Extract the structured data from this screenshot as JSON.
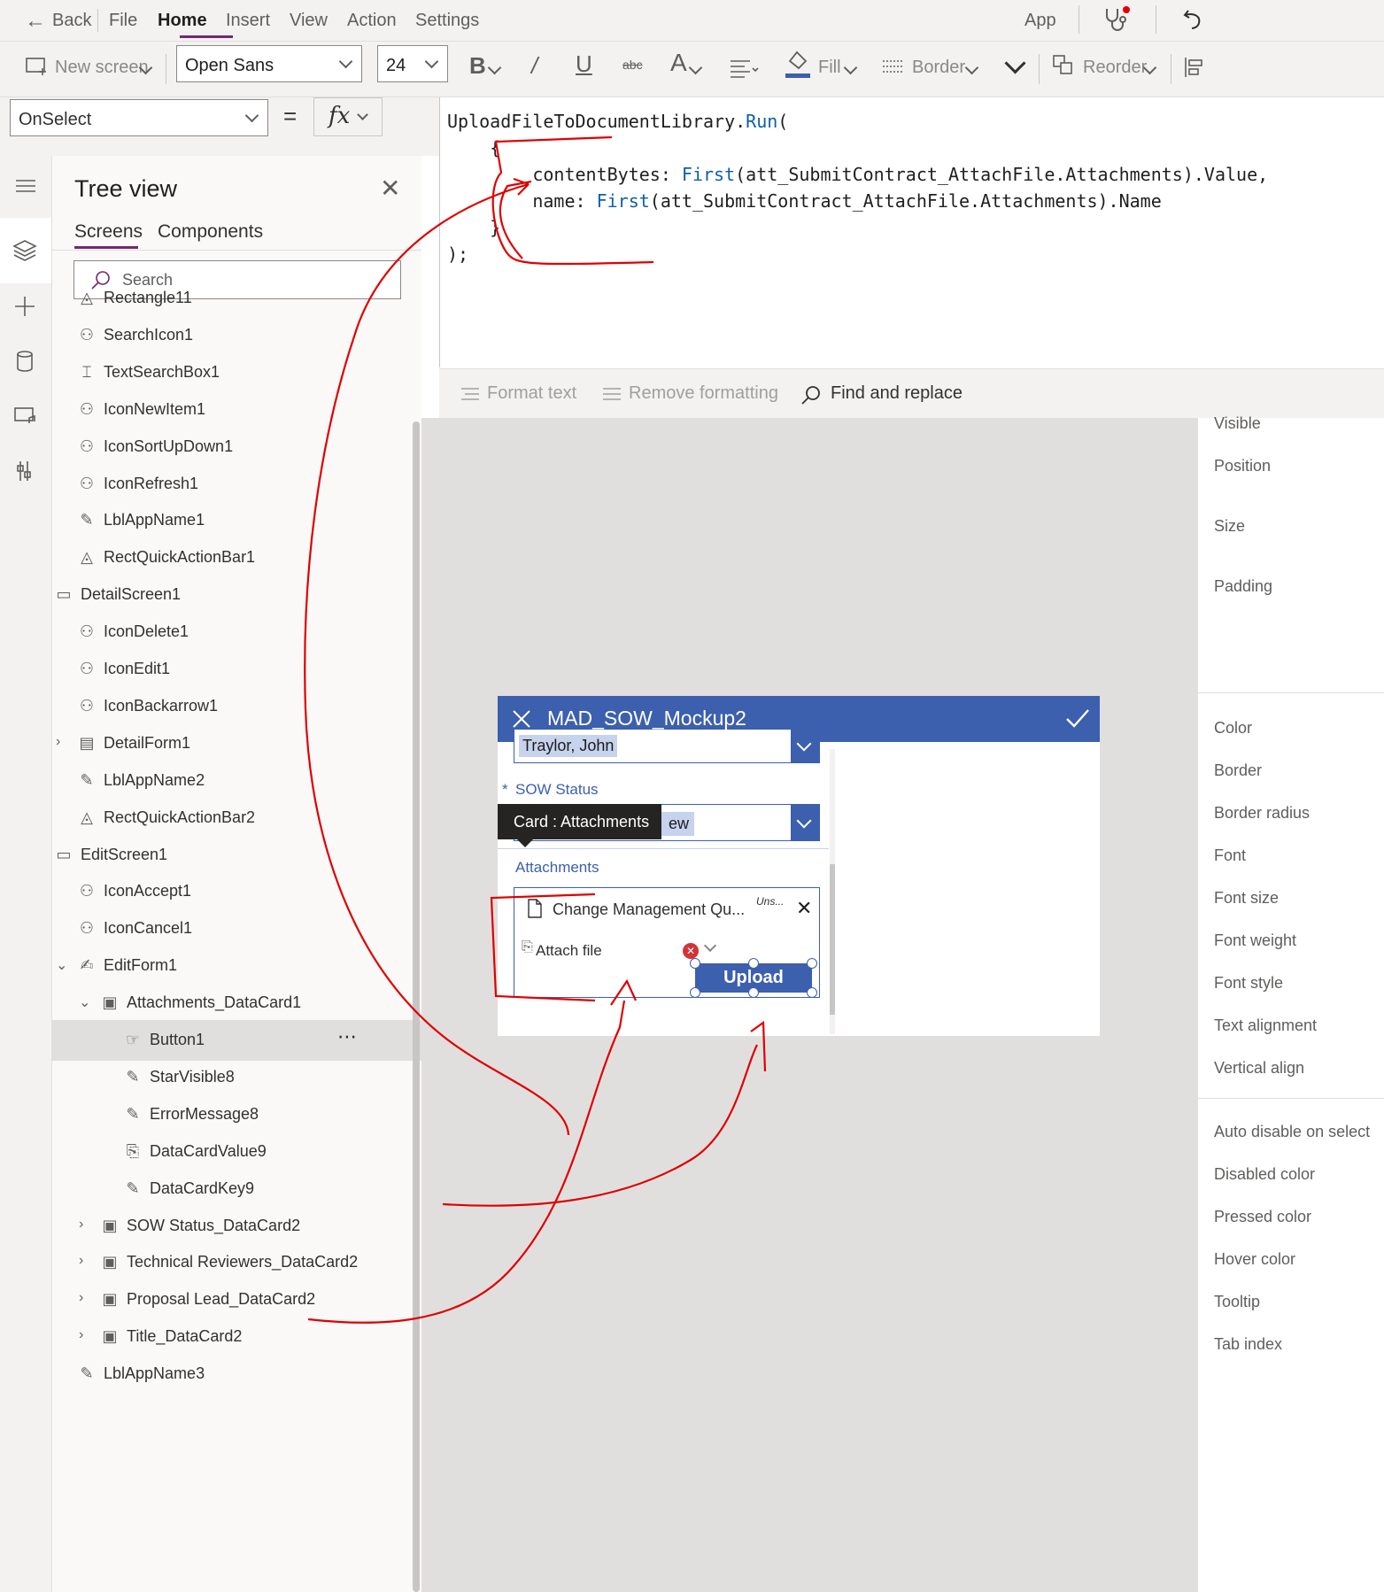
{
  "menu": {
    "back": "Back",
    "items": [
      "File",
      "Home",
      "Insert",
      "View",
      "Action",
      "Settings"
    ],
    "right_label": "App"
  },
  "toolbar": {
    "new_screen": "New screen",
    "font": "Open Sans",
    "font_size": "24",
    "fill": "Fill",
    "border": "Border",
    "reorder": "Reorder"
  },
  "formula": {
    "property": "OnSelect",
    "equals": "=",
    "fx": "fx",
    "lines": [
      {
        "plain": "UploadFileToDocumentLibrary.",
        "fn": "Run",
        "rest": "("
      },
      {
        "plain": "    {",
        "fn": "",
        "rest": ""
      },
      {
        "plain": "        contentBytes: ",
        "fn": "First",
        "rest": "(att_SubmitContract_AttachFile.Attachments).Value,"
      },
      {
        "plain": "        name: ",
        "fn": "First",
        "rest": "(att_SubmitContract_AttachFile.Attachments).Name"
      },
      {
        "plain": "    }",
        "fn": "",
        "rest": ""
      },
      {
        "plain": ");",
        "fn": "",
        "rest": ""
      }
    ]
  },
  "formatbar": {
    "format_text": "Format text",
    "remove_formatting": "Remove formatting",
    "find_replace": "Find and replace"
  },
  "tree": {
    "title": "Tree view",
    "tabs": [
      "Screens",
      "Components"
    ],
    "search_placeholder": "Search",
    "nodes": [
      {
        "label": "Rectangle11",
        "icon": "shape-icon",
        "indent": 1,
        "twisty": ""
      },
      {
        "label": "SearchIcon1",
        "icon": "icons-icon",
        "indent": 1,
        "twisty": ""
      },
      {
        "label": "TextSearchBox1",
        "icon": "textinput-icon",
        "indent": 1,
        "twisty": ""
      },
      {
        "label": "IconNewItem1",
        "icon": "icons-icon",
        "indent": 1,
        "twisty": ""
      },
      {
        "label": "IconSortUpDown1",
        "icon": "icons-icon",
        "indent": 1,
        "twisty": ""
      },
      {
        "label": "IconRefresh1",
        "icon": "icons-icon",
        "indent": 1,
        "twisty": ""
      },
      {
        "label": "LblAppName1",
        "icon": "label-icon",
        "indent": 1,
        "twisty": ""
      },
      {
        "label": "RectQuickActionBar1",
        "icon": "shape-icon",
        "indent": 1,
        "twisty": ""
      },
      {
        "label": "DetailScreen1",
        "icon": "screen-icon",
        "indent": 0,
        "twisty": ""
      },
      {
        "label": "IconDelete1",
        "icon": "icons-icon",
        "indent": 1,
        "twisty": ""
      },
      {
        "label": "IconEdit1",
        "icon": "icons-icon",
        "indent": 1,
        "twisty": ""
      },
      {
        "label": "IconBackarrow1",
        "icon": "icons-icon",
        "indent": 1,
        "twisty": ""
      },
      {
        "label": "DetailForm1",
        "icon": "form-icon",
        "indent": 1,
        "twisty": ">"
      },
      {
        "label": "LblAppName2",
        "icon": "label-icon",
        "indent": 1,
        "twisty": ""
      },
      {
        "label": "RectQuickActionBar2",
        "icon": "shape-icon",
        "indent": 1,
        "twisty": ""
      },
      {
        "label": "EditScreen1",
        "icon": "screen-icon",
        "indent": 0,
        "twisty": ""
      },
      {
        "label": "IconAccept1",
        "icon": "icons-icon",
        "indent": 1,
        "twisty": ""
      },
      {
        "label": "IconCancel1",
        "icon": "icons-icon",
        "indent": 1,
        "twisty": ""
      },
      {
        "label": "EditForm1",
        "icon": "editform-icon",
        "indent": 1,
        "twisty": "v"
      },
      {
        "label": "Attachments_DataCard1",
        "icon": "card-icon",
        "indent": 2,
        "twisty": "v"
      },
      {
        "label": "Button1",
        "icon": "button-icon",
        "indent": 3,
        "twisty": "",
        "selected": true
      },
      {
        "label": "StarVisible8",
        "icon": "label-icon",
        "indent": 3,
        "twisty": ""
      },
      {
        "label": "ErrorMessage8",
        "icon": "label-icon",
        "indent": 3,
        "twisty": ""
      },
      {
        "label": "DataCardValue9",
        "icon": "paperclip-icon",
        "indent": 3,
        "twisty": ""
      },
      {
        "label": "DataCardKey9",
        "icon": "label-icon",
        "indent": 3,
        "twisty": ""
      },
      {
        "label": "SOW Status_DataCard2",
        "icon": "card-icon",
        "indent": 2,
        "twisty": ">"
      },
      {
        "label": "Technical Reviewers_DataCard2",
        "icon": "card-icon",
        "indent": 2,
        "twisty": ">"
      },
      {
        "label": "Proposal Lead_DataCard2",
        "icon": "card-icon",
        "indent": 2,
        "twisty": ">"
      },
      {
        "label": "Title_DataCard2",
        "icon": "card-icon",
        "indent": 2,
        "twisty": ">"
      },
      {
        "label": "LblAppName3",
        "icon": "label-icon",
        "indent": 1,
        "twisty": ""
      }
    ]
  },
  "properties": {
    "group1": [
      "Visible",
      "Position",
      "Size",
      "Padding"
    ],
    "group2": [
      "Color",
      "Border",
      "Border radius",
      "Font",
      "Font size",
      "Font weight",
      "Font style",
      "Text alignment",
      "Vertical align"
    ],
    "group3": [
      "Auto disable on select",
      "Disabled color",
      "Pressed color",
      "Hover color",
      "Tooltip",
      "Tab index"
    ]
  },
  "app": {
    "title": "MAD_SOW_Mockup2",
    "person_value": "Traylor, John",
    "required_star": "*",
    "status_label": "SOW Status",
    "status_value_fragment": "ew",
    "tooltip": "Card : Attachments",
    "attachments_label": "Attachments",
    "file_name": "Change Management Qu...",
    "file_status": "Uns...",
    "attach_file": "Attach file",
    "upload": "Upload"
  },
  "colors": {
    "accent_purple": "#742774",
    "app_blue": "#3c5fae",
    "annotation_red": "#e00000"
  }
}
